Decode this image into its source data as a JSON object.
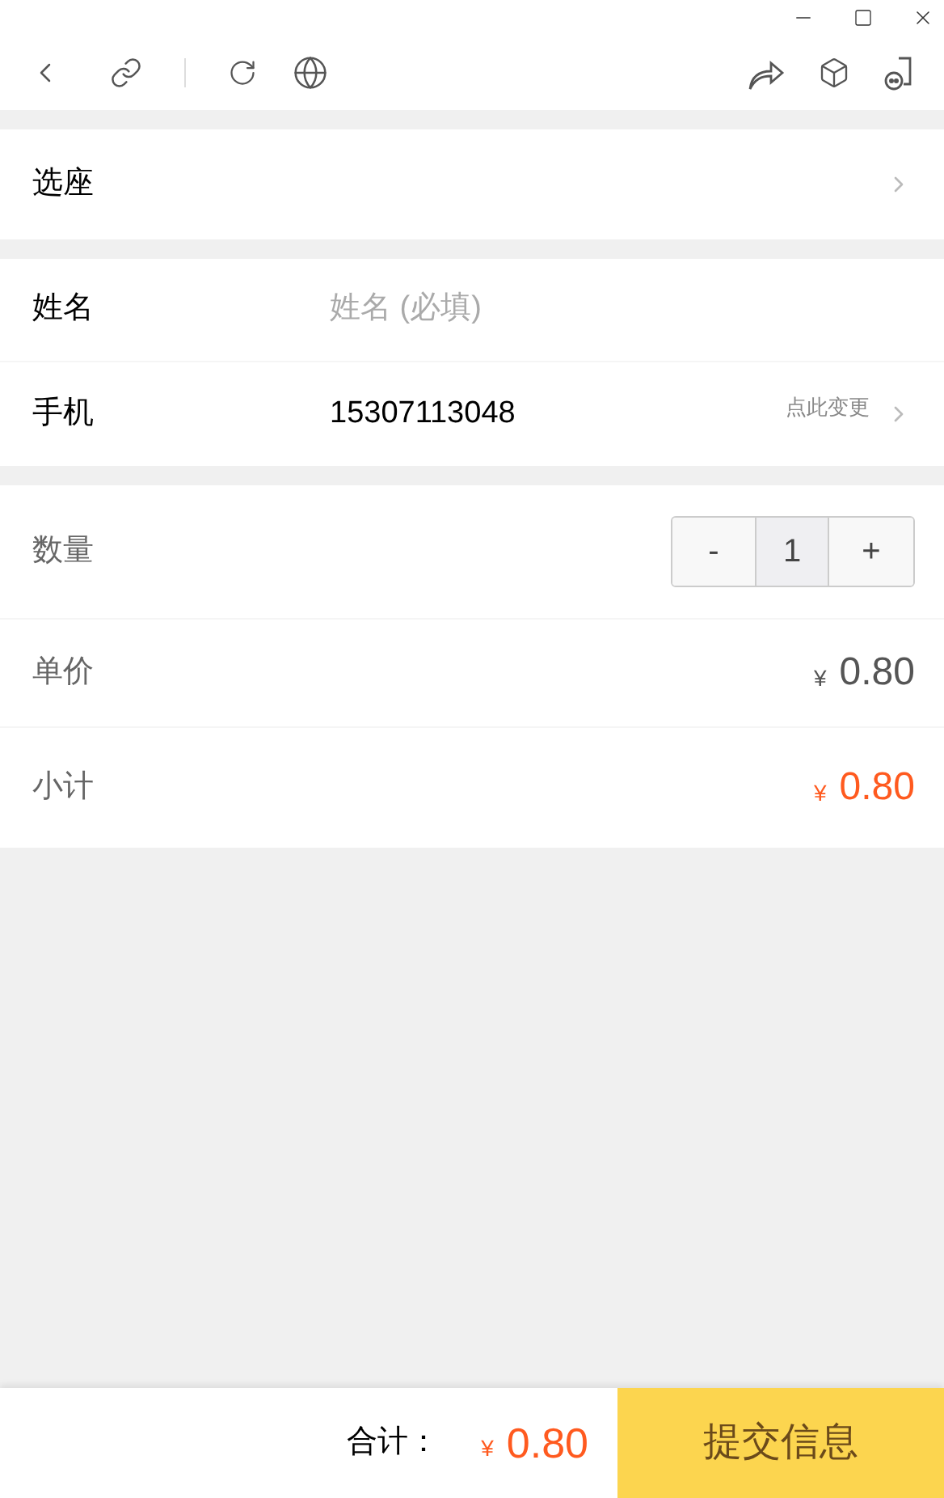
{
  "seat": {
    "label": "选座"
  },
  "contact": {
    "name": {
      "label": "姓名",
      "placeholder": "姓名 (必填)"
    },
    "phone": {
      "label": "手机",
      "value": "15307113048",
      "action": "点此变更"
    }
  },
  "order": {
    "quantity": {
      "label": "数量",
      "minus": "-",
      "value": "1",
      "plus": "+"
    },
    "unit_price": {
      "label": "单价",
      "currency": "¥",
      "value": "0.80"
    },
    "subtotal": {
      "label": "小计",
      "currency": "¥",
      "value": "0.80"
    }
  },
  "footer": {
    "total_label": "合计：",
    "currency": "¥",
    "total": "0.80",
    "submit": "提交信息"
  }
}
